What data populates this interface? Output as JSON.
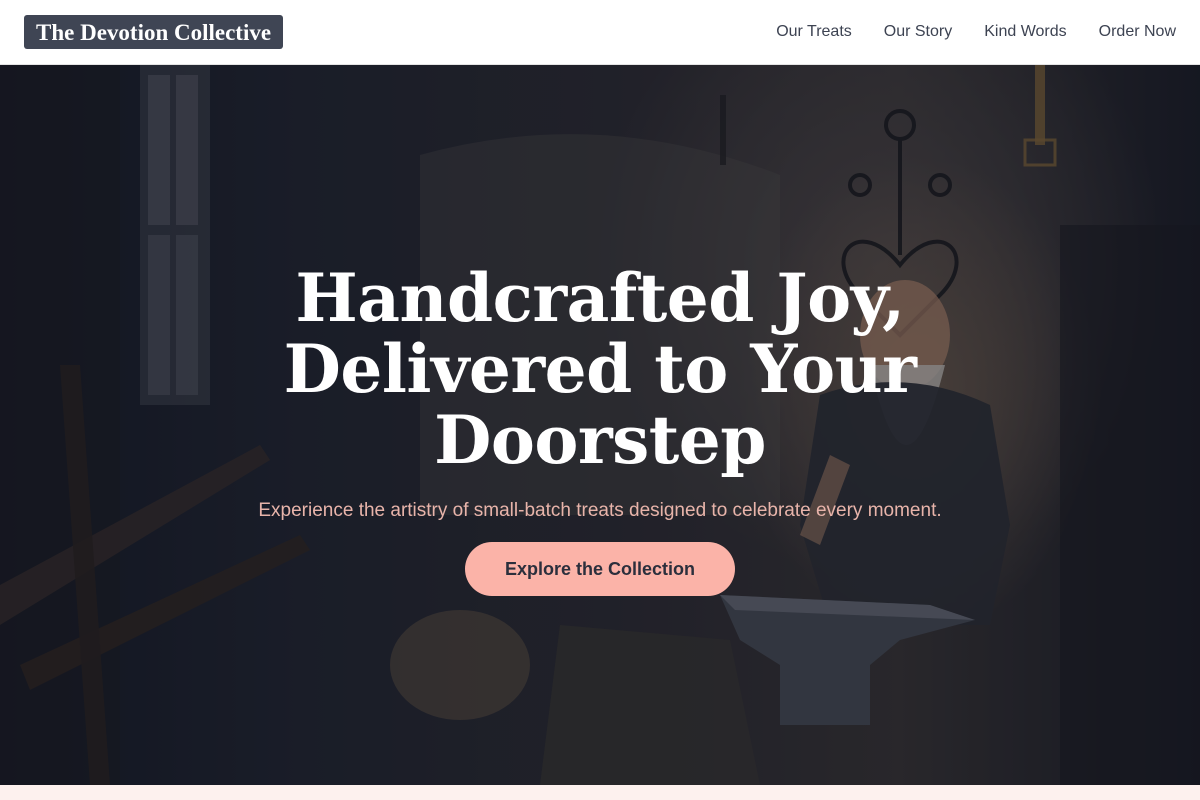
{
  "header": {
    "logo_text": "The Devotion Collective",
    "nav": [
      {
        "label": "Our Treats"
      },
      {
        "label": "Our Story"
      },
      {
        "label": "Kind Words"
      },
      {
        "label": "Order Now"
      }
    ]
  },
  "hero": {
    "title": "Handcrafted Joy, Delivered to Your Doorstep",
    "subtitle": "Experience the artistry of small-batch treats designed to celebrate every moment.",
    "cta_label": "Explore the Collection",
    "background_image": "blacksmith-workshop-photo"
  },
  "colors": {
    "nav_bg": "#ffffff",
    "logo_bg": "#3f4554",
    "cta_bg": "#fbb3a8",
    "subtitle": "#e8b4aa",
    "page_bg": "#fdf1ee"
  }
}
